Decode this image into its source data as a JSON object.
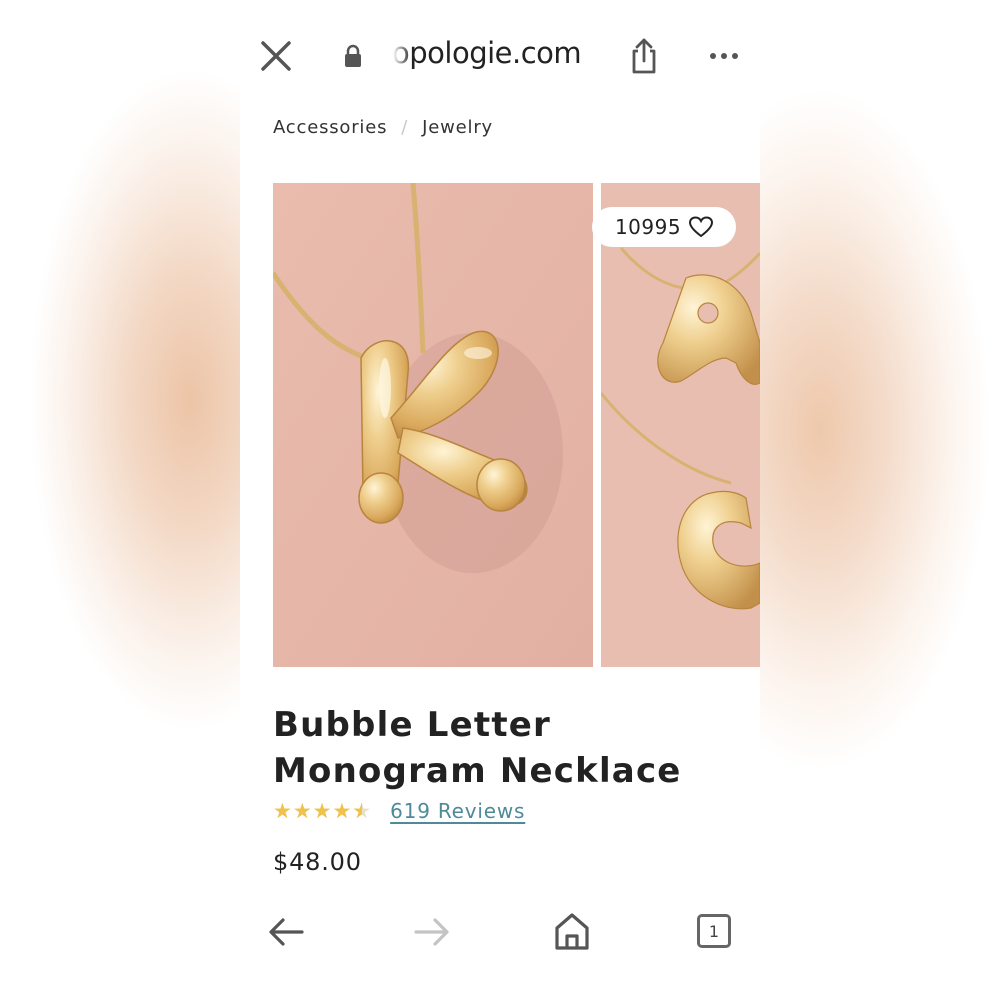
{
  "browser": {
    "url_text": "opologie.com",
    "icons": {
      "close": "close-icon",
      "lock": "lock-icon",
      "share": "share-icon",
      "more": "more-icon"
    }
  },
  "breadcrumb": {
    "items": [
      "Accessories",
      "Jewelry"
    ],
    "separator": "/"
  },
  "gallery": {
    "favorites_count": "10995",
    "images": [
      {
        "depicts": "gold bubble letter K pendant"
      },
      {
        "depicts": "gold bubble letter A and C pendants"
      }
    ],
    "dots_count": 2,
    "active_dot": 0
  },
  "product": {
    "title": "Bubble Letter Monogram Necklace",
    "rating": 4.5,
    "rating_max": 5,
    "stars_text": "★★★★★",
    "reviews_label": "619 Reviews",
    "price": "$48.00"
  },
  "bottom_nav": {
    "tab_count": "1",
    "icons": [
      "back-arrow-icon",
      "forward-arrow-icon",
      "home-icon",
      "tabs-icon"
    ]
  },
  "colors": {
    "accent_link": "#4f8a99",
    "star": "#f0c24a",
    "image_bg": "#e6b9ab",
    "gold": "#e8c27a"
  }
}
